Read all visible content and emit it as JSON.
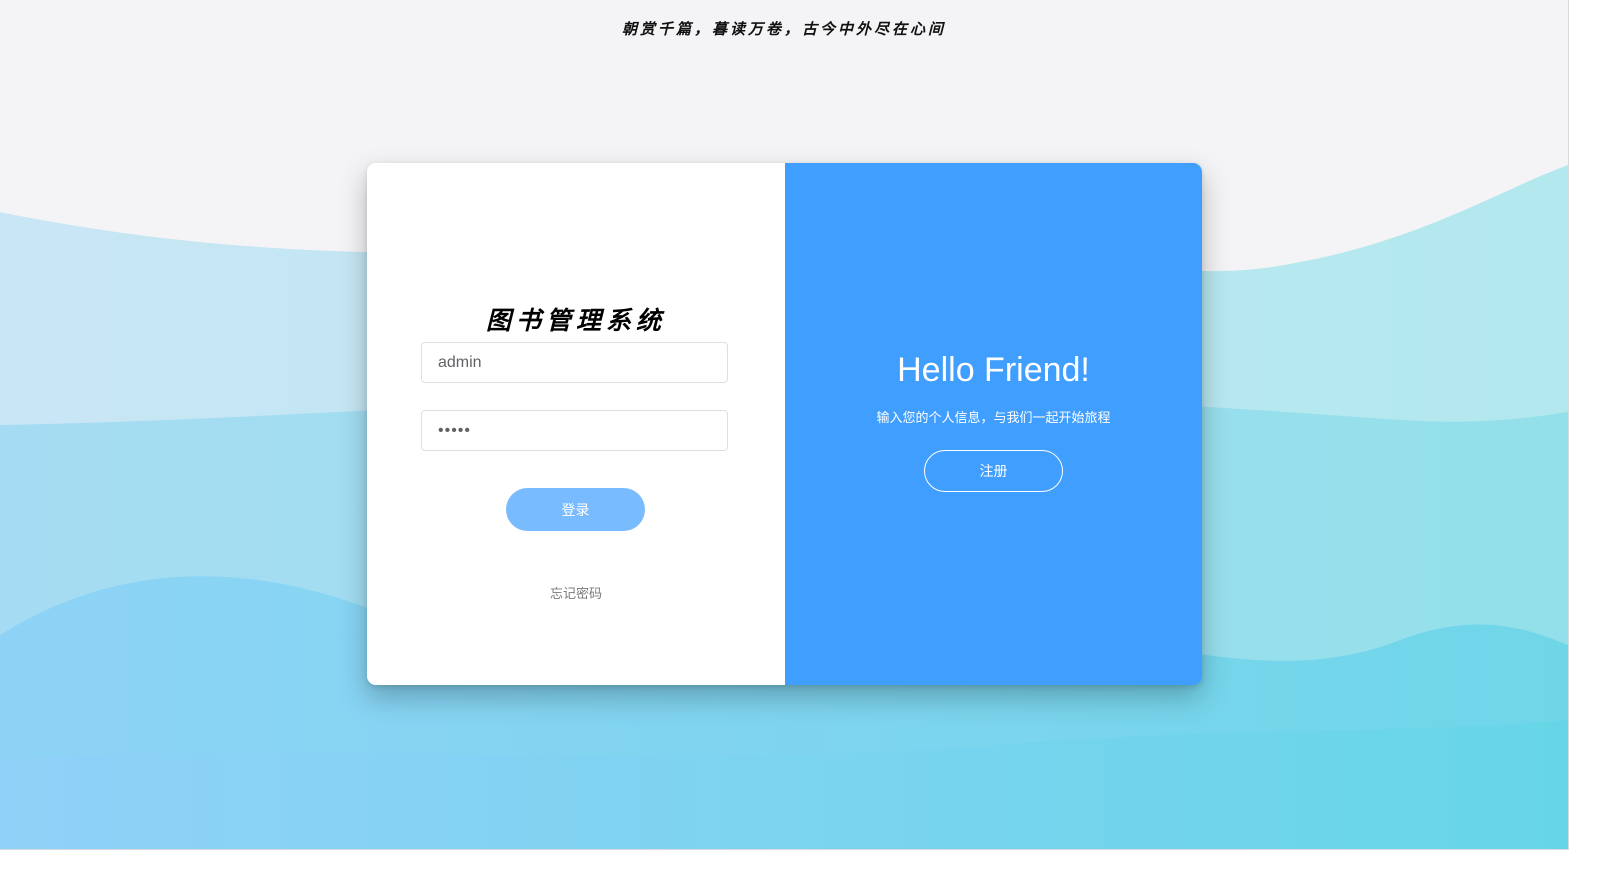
{
  "header": {
    "tagline": "朝赏千篇，暮读万卷，古今中外尽在心间"
  },
  "login": {
    "title": "图书管理系统",
    "username_value": "admin",
    "password_value": "•••••",
    "login_button": "登录",
    "forgot_link": "忘记密码"
  },
  "welcome": {
    "heading": "Hello Friend!",
    "subtitle": "输入您的个人信息，与我们一起开始旅程",
    "register_button": "注册"
  },
  "colors": {
    "accent": "#409eff",
    "login_button": "#79bbff",
    "background": "#f4f4f6"
  }
}
